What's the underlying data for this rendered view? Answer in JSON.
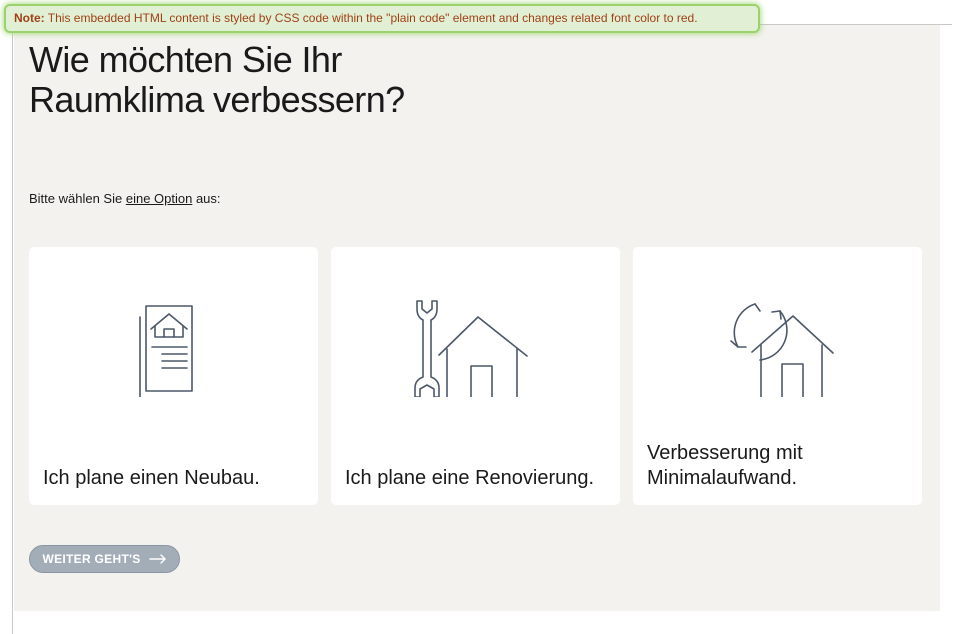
{
  "note": {
    "label": "Note:",
    "text": "This embedded HTML content is styled by CSS code within the \"plain code\" element and changes related font color to red."
  },
  "page": {
    "title_line1": "Wie möchten Sie Ihr",
    "title_line2": "Raumklima verbessern?",
    "prompt_before": "Bitte wählen Sie ",
    "prompt_link": "eine Option",
    "prompt_after": " aus:"
  },
  "options": [
    {
      "icon": "house-document-icon",
      "label": "Ich plane einen Neubau."
    },
    {
      "icon": "wrench-house-icon",
      "label": "Ich plane eine Renovierung."
    },
    {
      "icon": "refresh-house-icon",
      "label_line1": "Verbesserung mit",
      "label_line2": "Minimalaufwand."
    }
  ],
  "actions": {
    "next_label": "WEITER GEHT'S"
  },
  "colors": {
    "panel_background": "#f3f2ef",
    "icon_stroke": "#4c5869",
    "note_text": "#a04016",
    "note_border": "#9bd26e",
    "button_background": "#a3adb8"
  }
}
